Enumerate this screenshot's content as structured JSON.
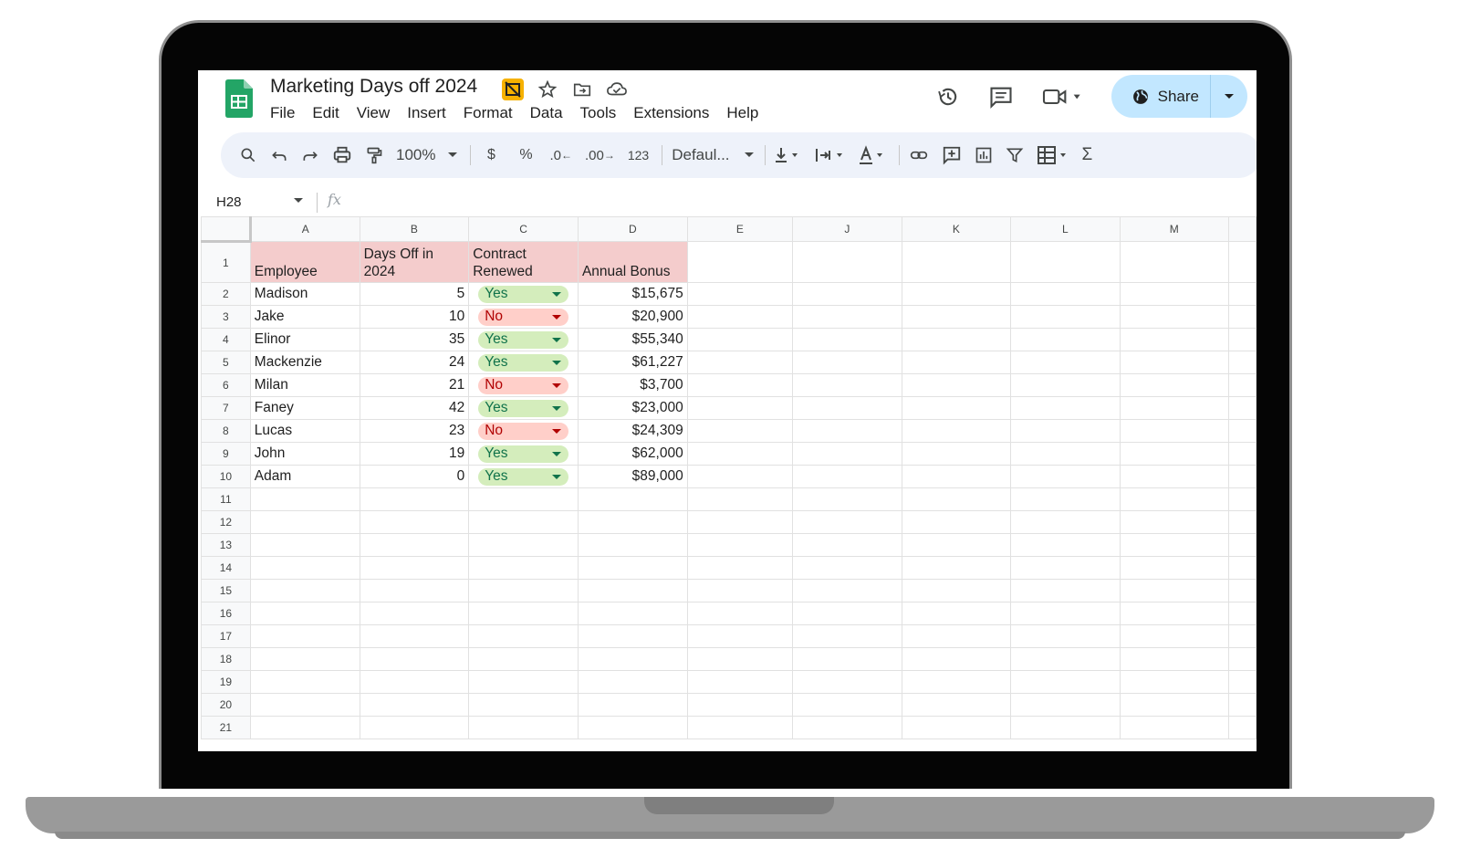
{
  "doc": {
    "title": "Marketing Days off 2024",
    "menu": [
      "File",
      "Edit",
      "View",
      "Insert",
      "Format",
      "Data",
      "Tools",
      "Extensions",
      "Help"
    ],
    "share_label": "Share"
  },
  "toolbar": {
    "zoom": "100%",
    "currency": "$",
    "percent": "%",
    "dec_decrease": ".0",
    "dec_increase": ".00",
    "number_format": "123",
    "font": "Defaul...",
    "sum": "Σ"
  },
  "formula_bar": {
    "name_box": "H28",
    "fx": "fx"
  },
  "sheet": {
    "columns": [
      "A",
      "B",
      "C",
      "D",
      "E",
      "J",
      "K",
      "L",
      "M"
    ],
    "header_row": {
      "a": "Employee",
      "b": "Days Off in 2024",
      "c": "Contract Renewed",
      "d": "Annual Bonus"
    },
    "rows": [
      {
        "name": "Madison",
        "days": "5",
        "renewed": "Yes",
        "bonus": "$15,675"
      },
      {
        "name": "Jake",
        "days": "10",
        "renewed": "No",
        "bonus": "$20,900"
      },
      {
        "name": "Elinor",
        "days": "35",
        "renewed": "Yes",
        "bonus": "$55,340"
      },
      {
        "name": "Mackenzie",
        "days": "24",
        "renewed": "Yes",
        "bonus": "$61,227"
      },
      {
        "name": "Milan",
        "days": "21",
        "renewed": "No",
        "bonus": "$3,700"
      },
      {
        "name": "Faney",
        "days": "42",
        "renewed": "Yes",
        "bonus": "$23,000"
      },
      {
        "name": "Lucas",
        "days": "23",
        "renewed": "No",
        "bonus": "$24,309"
      },
      {
        "name": "John",
        "days": "19",
        "renewed": "Yes",
        "bonus": "$62,000"
      },
      {
        "name": "Adam",
        "days": "0",
        "renewed": "Yes",
        "bonus": "$89,000"
      }
    ],
    "row_numbers": [
      "1",
      "2",
      "3",
      "4",
      "5",
      "6",
      "7",
      "8",
      "9",
      "10",
      "11",
      "12",
      "13",
      "14",
      "15",
      "16",
      "17",
      "18",
      "19",
      "20",
      "21"
    ]
  },
  "icons": [
    "sheets-logo-icon",
    "move-icon",
    "star-icon",
    "folder-move-icon",
    "cloud-status-icon",
    "history-icon",
    "comment-icon",
    "meet-icon",
    "globe-icon",
    "search-icon",
    "undo-icon",
    "redo-icon",
    "print-icon",
    "paint-format-icon",
    "vertical-align-icon",
    "wrap-icon",
    "text-color-icon",
    "link-icon",
    "insert-comment-icon",
    "chart-icon",
    "filter-icon",
    "table-icon"
  ]
}
